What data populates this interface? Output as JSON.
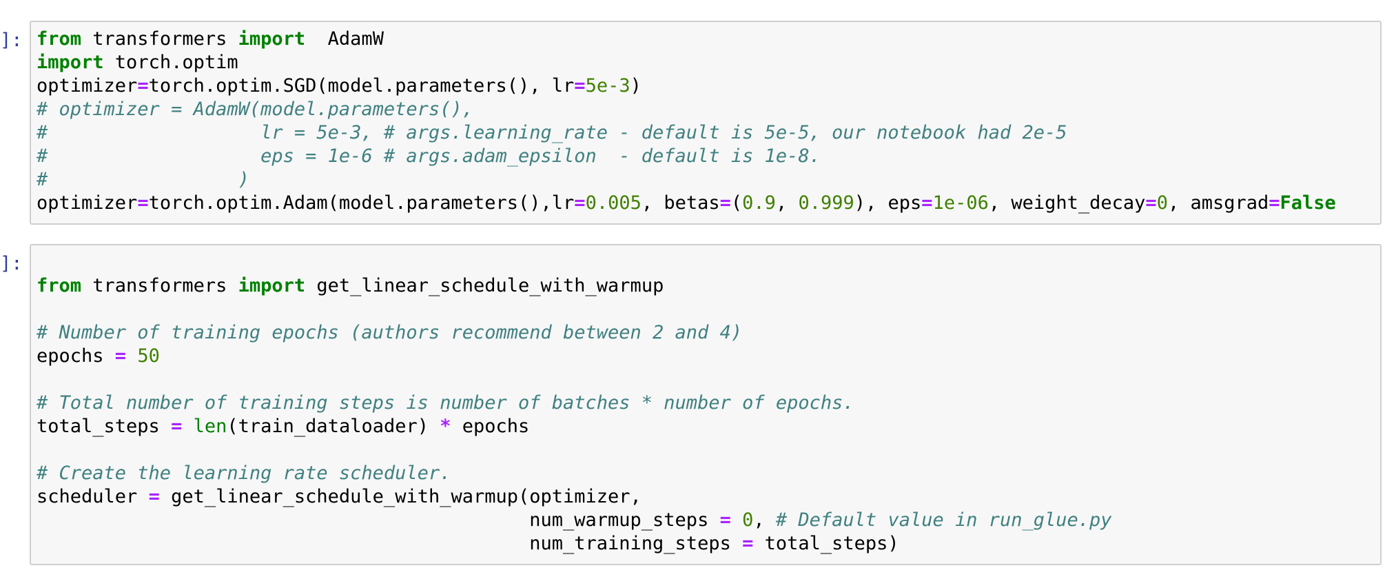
{
  "cells": [
    {
      "prompt": "]:",
      "lines": [
        [
          [
            "kw",
            "from"
          ],
          [
            "t",
            " transformers "
          ],
          [
            "kw",
            "import"
          ],
          [
            "t",
            "  AdamW"
          ]
        ],
        [
          [
            "kw",
            "import"
          ],
          [
            "t",
            " torch.optim"
          ]
        ],
        [
          [
            "t",
            "optimizer"
          ],
          [
            "op",
            "="
          ],
          [
            "t",
            "torch.optim.SGD(model.parameters(), lr"
          ],
          [
            "op",
            "="
          ],
          [
            "num",
            "5e-3"
          ],
          [
            "t",
            ")"
          ]
        ],
        [
          [
            "cm",
            "# optimizer = AdamW(model.parameters(),"
          ]
        ],
        [
          [
            "cm",
            "#                   lr = 5e-3, # args.learning_rate - default is 5e-5, our notebook had 2e-5"
          ]
        ],
        [
          [
            "cm",
            "#                   eps = 1e-6 # args.adam_epsilon  - default is 1e-8."
          ]
        ],
        [
          [
            "cm",
            "#                 )"
          ]
        ],
        [
          [
            "t",
            "optimizer"
          ],
          [
            "op",
            "="
          ],
          [
            "t",
            "torch.optim.Adam(model.parameters(),lr"
          ],
          [
            "op",
            "="
          ],
          [
            "num",
            "0.005"
          ],
          [
            "t",
            ", betas"
          ],
          [
            "op",
            "="
          ],
          [
            "t",
            "("
          ],
          [
            "num",
            "0.9"
          ],
          [
            "t",
            ", "
          ],
          [
            "num",
            "0.999"
          ],
          [
            "t",
            "), eps"
          ],
          [
            "op",
            "="
          ],
          [
            "num",
            "1e-06"
          ],
          [
            "t",
            ", weight_decay"
          ],
          [
            "op",
            "="
          ],
          [
            "num",
            "0"
          ],
          [
            "t",
            ", amsgrad"
          ],
          [
            "op",
            "="
          ],
          [
            "kc",
            "False"
          ]
        ]
      ]
    },
    {
      "prompt": "]:",
      "lines": [
        [
          [
            "t",
            ""
          ]
        ],
        [
          [
            "kw",
            "from"
          ],
          [
            "t",
            " transformers "
          ],
          [
            "kw",
            "import"
          ],
          [
            "t",
            " get_linear_schedule_with_warmup"
          ]
        ],
        [
          [
            "t",
            ""
          ]
        ],
        [
          [
            "cm",
            "# Number of training epochs (authors recommend between 2 and 4)"
          ]
        ],
        [
          [
            "t",
            "epochs "
          ],
          [
            "op",
            "="
          ],
          [
            "t",
            " "
          ],
          [
            "num",
            "50"
          ]
        ],
        [
          [
            "t",
            ""
          ]
        ],
        [
          [
            "cm",
            "# Total number of training steps is number of batches * number of epochs."
          ]
        ],
        [
          [
            "t",
            "total_steps "
          ],
          [
            "op",
            "="
          ],
          [
            "t",
            " "
          ],
          [
            "bi",
            "len"
          ],
          [
            "t",
            "(train_dataloader) "
          ],
          [
            "op",
            "*"
          ],
          [
            "t",
            " epochs"
          ]
        ],
        [
          [
            "t",
            ""
          ]
        ],
        [
          [
            "cm",
            "# Create the learning rate scheduler."
          ]
        ],
        [
          [
            "t",
            "scheduler "
          ],
          [
            "op",
            "="
          ],
          [
            "t",
            " get_linear_schedule_with_warmup(optimizer,"
          ]
        ],
        [
          [
            "t",
            "                                            num_warmup_steps "
          ],
          [
            "op",
            "="
          ],
          [
            "t",
            " "
          ],
          [
            "num",
            "0"
          ],
          [
            "t",
            ", "
          ],
          [
            "cm",
            "# Default value in run_glue.py"
          ]
        ],
        [
          [
            "t",
            "                                            num_training_steps "
          ],
          [
            "op",
            "="
          ],
          [
            "t",
            " total_steps)"
          ]
        ]
      ]
    }
  ]
}
